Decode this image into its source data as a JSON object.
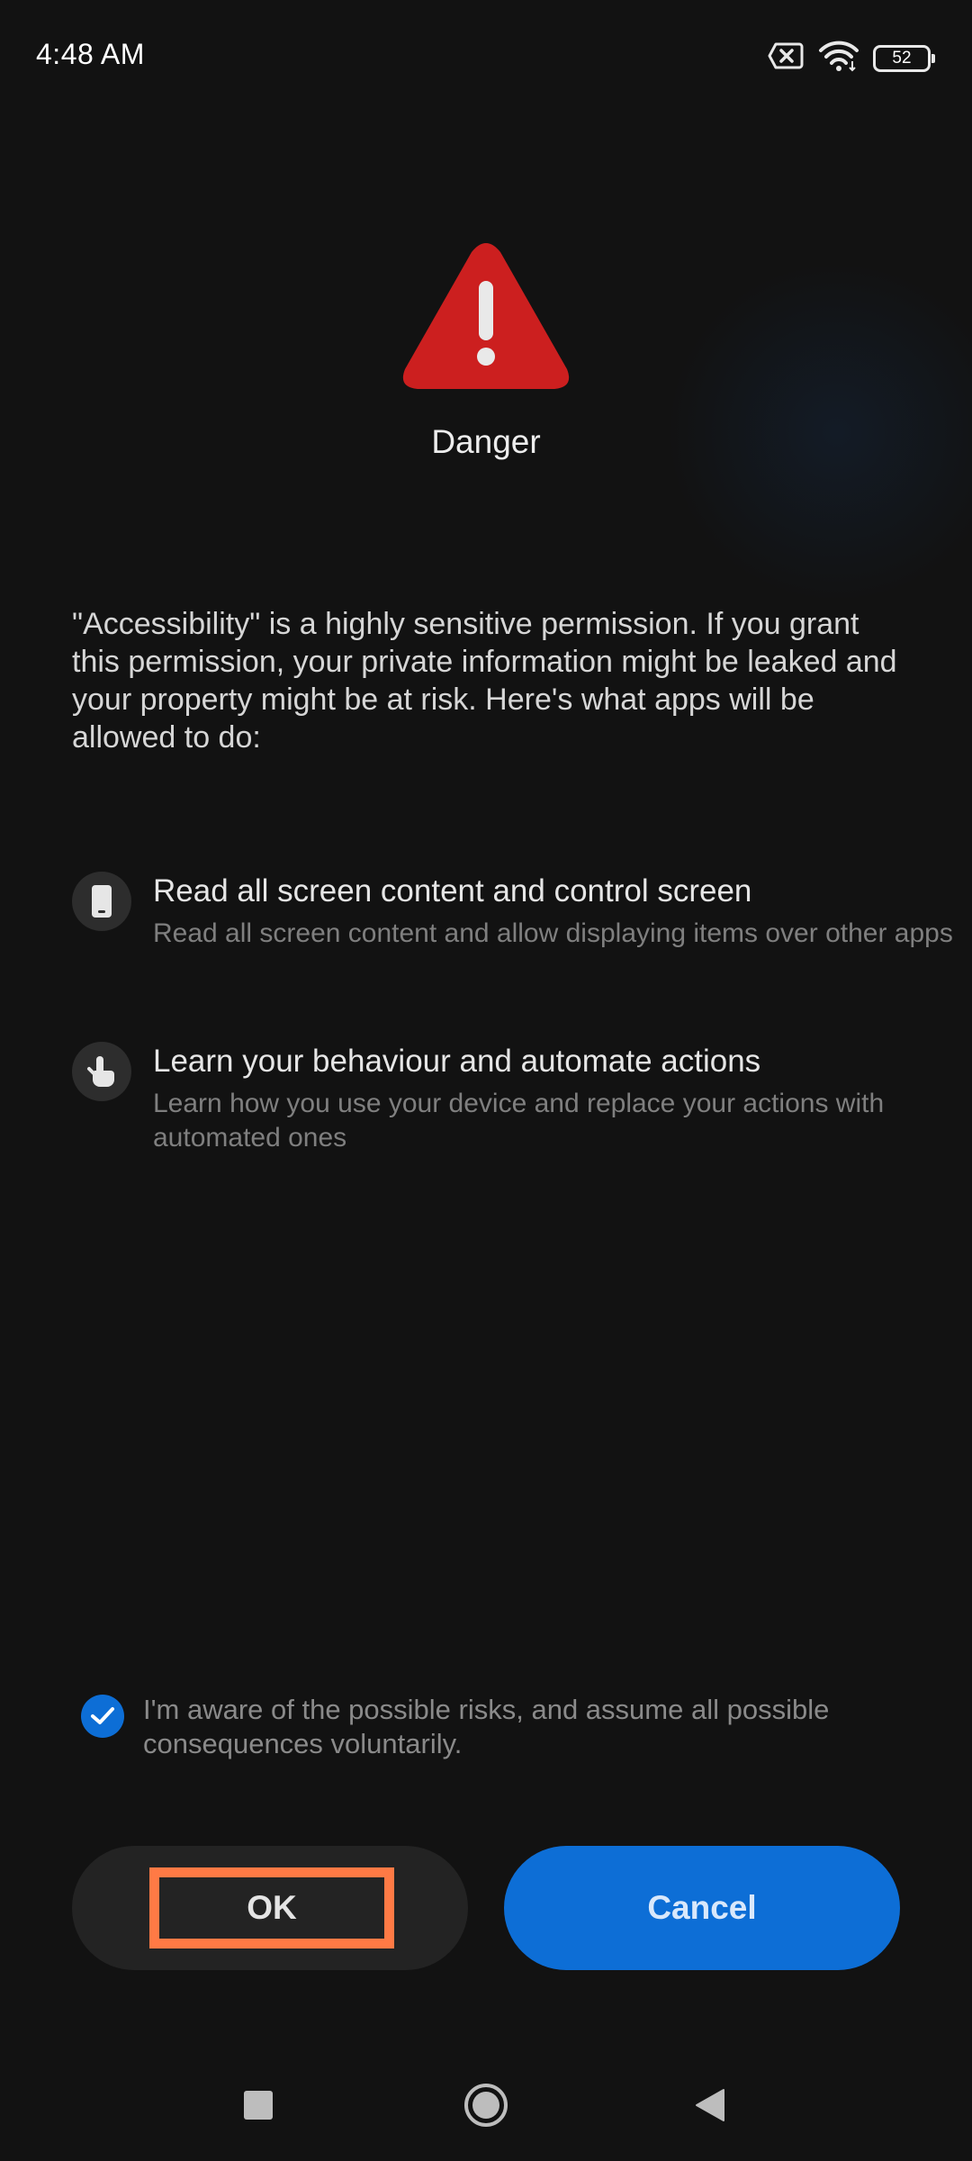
{
  "status_bar": {
    "time": "4:48 AM",
    "battery_level": "52",
    "icons": [
      "no-sim-icon",
      "wifi-icon",
      "battery-icon"
    ]
  },
  "dialog": {
    "icon": "warning-triangle-icon",
    "icon_color": "#cc1f1f",
    "title": "Danger",
    "description": "\"Accessibility\" is a highly sensitive permission. If you grant this permission, your private information might be leaked and your property might be at risk. Here's what apps will be allowed to do:",
    "permissions": [
      {
        "icon": "phone-icon",
        "title": "Read all screen content and control screen",
        "description": "Read all screen content and allow displaying items over other apps"
      },
      {
        "icon": "hand-pointer-icon",
        "title": "Learn your behaviour and automate actions",
        "description": "Learn how you use your device and replace your actions with automated ones"
      }
    ],
    "consent": {
      "checked": true,
      "text": "I'm aware of the possible risks, and assume all possible consequences voluntarily."
    },
    "ok_label": "OK",
    "cancel_label": "Cancel",
    "accent_color": "#0d6ed6",
    "highlight_color": "#ff7a45"
  },
  "nav_bar": {
    "buttons": [
      "recents-icon",
      "home-icon",
      "back-icon"
    ]
  }
}
